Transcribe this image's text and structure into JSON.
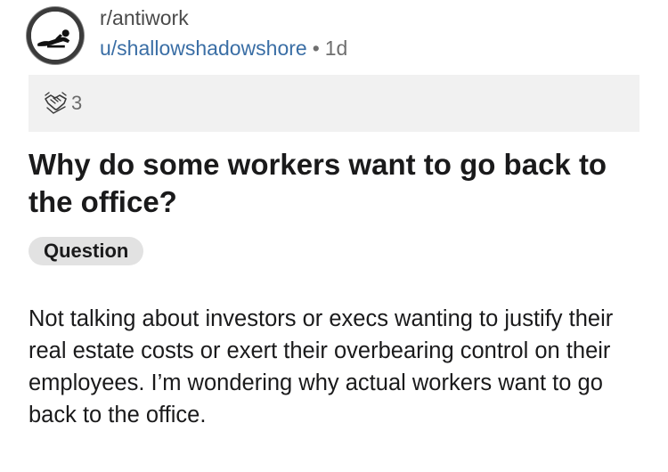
{
  "post": {
    "subreddit": "r/antiwork",
    "author": "u/shallowshadowshore",
    "separator": "•",
    "age": "1d",
    "awards": {
      "icon": "handshake-award-icon",
      "count": "3"
    },
    "title": "Why do some workers want to go back to the office?",
    "flair": "Question",
    "body": "Not talking about investors or execs wanting to justify their real estate costs or exert their overbearing control on their employees. I’m wondering why actual workers want to go back to the office."
  },
  "colors": {
    "username": "#3a6ea5",
    "awards_bg": "#f1f1f1",
    "flair_bg": "#e2e2e2",
    "text": "#1a1a1b"
  }
}
